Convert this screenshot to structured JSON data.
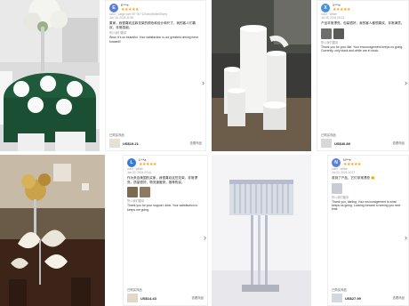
{
  "reviews": [
    {
      "avatar_letter": "E",
      "avatar_color": "#5b7fd6",
      "user": "E***e",
      "stars": "★★★★★",
      "sku": "color : Large size 90 *30 *120cm(White/Silver)",
      "date": "Jun 16, 2024 11:56",
      "cn": "果家，我很喜欢这款花架的颜色和设计和尺寸，我的客人们喜欢，非常感谢。",
      "trans_label": "所以我们翻译",
      "en": "Wow, It's so beautiful. Your satisfaction is our greatest driving force forward!!",
      "product_title": "已购买商品",
      "price": "US$19.21",
      "seeall": "查看商品"
    },
    {
      "avatar_letter": "X",
      "avatar_color": "#4a90d9",
      "user": "X***b",
      "stars": "★★★★★",
      "sku": "color : White",
      "date": "Jul 08, 2024 06:12",
      "cn": "产品非常漂亮，包装很好，我的客人都很喜欢，非常满意。",
      "trans_label": "所以我们翻译",
      "en": "Thank you for your like. Your encouragement keeps us going. Currently, only black and white are in stock.",
      "product_title": "已购买商品",
      "price": "US$40.89",
      "seeall": "查看商品"
    },
    {
      "avatar_letter": "L",
      "avatar_color": "#3a7bd5",
      "user": "L***a",
      "stars": "★★★★★",
      "sku": "color : White",
      "date": "Jun 20, 2024 09:41",
      "cn": "作为来自美国的买家，我很喜欢这些花架，非常漂亮，质量很好，物流速度快，推荐购买。",
      "trans_label": "所以我们翻译",
      "en": "Thank you for your support, dear. Your satisfaction is keeps me going.",
      "product_title": "已购买商品",
      "price": "US$14.43",
      "seeall": "查看商品"
    },
    {
      "avatar_letter": "N",
      "avatar_color": "#5b7fd6",
      "user": "N***e",
      "stars": "★★★★★",
      "sku": "color : White",
      "date": "Jul 02, 2024 14:27",
      "cn": "收到了产品，它们非常漂亮 😊",
      "trans_label": "所以我们翻译",
      "en": "Thank you, darling. Your encouragement is what keeps us going. Looking forward to seeing you next time.",
      "product_title": "已购买商品",
      "price": "US$27.99",
      "seeall": "查看商品"
    }
  ],
  "colors": {
    "star": "#f5a623",
    "table_green": "#1f5a3c",
    "cream": "#f2ece0"
  },
  "icons": {
    "next": "chevron-right-icon"
  }
}
